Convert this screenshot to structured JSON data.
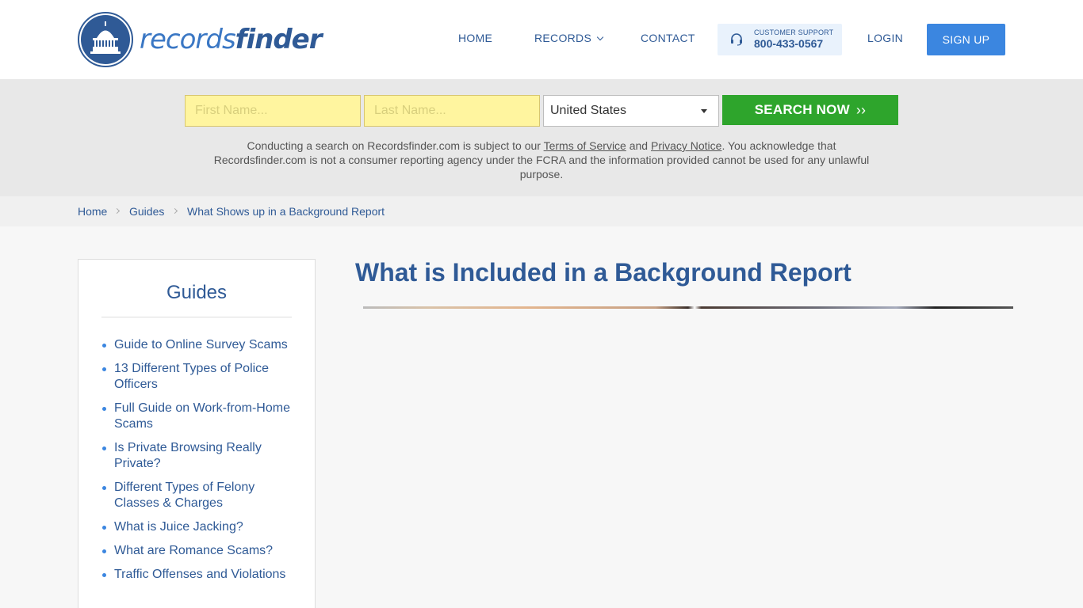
{
  "brand": {
    "name_light": "records",
    "name_bold": "finder"
  },
  "nav": {
    "home": "HOME",
    "records": "RECORDS",
    "contact": "CONTACT",
    "login": "LOGIN",
    "signup": "SIGN UP"
  },
  "support": {
    "label": "CUSTOMER SUPPORT",
    "phone": "800-433-0567"
  },
  "search": {
    "first_name_placeholder": "First Name...",
    "last_name_placeholder": "Last Name...",
    "country_selected": "United States",
    "button_label": "SEARCH NOW",
    "disclaimer_before": "Conducting a search on Recordsfinder.com is subject to our ",
    "terms_link": "Terms of Service",
    "disclaimer_and": " and ",
    "privacy_link": "Privacy Notice",
    "disclaimer_after": ". You acknowledge that Recordsfinder.com is not a consumer reporting agency under the FCRA and the information provided cannot be used for any unlawful purpose."
  },
  "breadcrumb": {
    "home": "Home",
    "guides": "Guides",
    "current": "What Shows up in a Background Report"
  },
  "sidebar": {
    "title": "Guides",
    "items": [
      "Guide to Online Survey Scams",
      "13 Different Types of Police Officers",
      "Full Guide on Work-from-Home Scams",
      "Is Private Browsing Really Private?",
      "Different Types of Felony Classes & Charges",
      "What is Juice Jacking?",
      "What are Romance Scams?",
      "Traffic Offenses and Violations"
    ]
  },
  "main": {
    "title": "What is Included in a Background Report"
  },
  "colors": {
    "brand_blue": "#2f5a96",
    "accent_blue": "#3b86e0",
    "search_green": "#2ea52c",
    "input_yellow": "#fff59f"
  }
}
